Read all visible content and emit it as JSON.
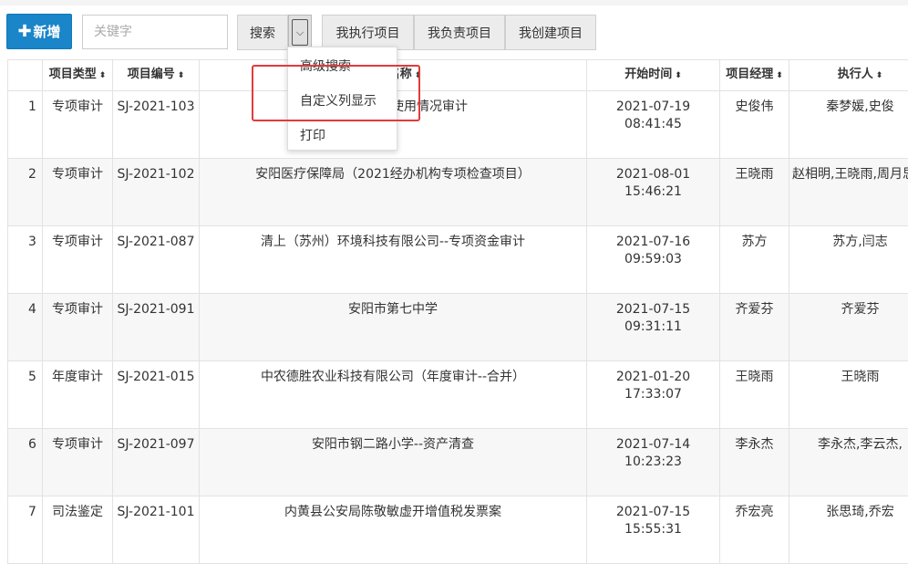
{
  "toolbar": {
    "add_label": "新增",
    "add_icon": "plus-icon",
    "keyword_placeholder": "关键字",
    "search_label": "搜索",
    "caret_icon": "chevron-down-icon",
    "filters": [
      "我执行项目",
      "我负责项目",
      "我创建项目"
    ]
  },
  "dropdown": {
    "items": [
      "高级搜索",
      "自定义列显示",
      "打印"
    ],
    "highlight_color": "#e23a3a"
  },
  "table": {
    "columns": [
      "",
      "项目类型",
      "项目编号",
      "项目名称",
      "开始时间",
      "项目经理",
      "执行人"
    ],
    "rows": [
      {
        "index": "1",
        "type": "专项审计",
        "code": "SJ-2021-103",
        "name": "大……--资金使用情况审计",
        "start": "2021-07-19 08:41:45",
        "manager": "史俊伟",
        "executor": "秦梦媛,史俊"
      },
      {
        "index": "2",
        "type": "专项审计",
        "code": "SJ-2021-102",
        "name": "安阳医疗保障局（2021经办机构专项检查项目）",
        "start": "2021-08-01 15:46:21",
        "manager": "王晓雨",
        "executor": "赵相明,王晓雨,周月思雨"
      },
      {
        "index": "3",
        "type": "专项审计",
        "code": "SJ-2021-087",
        "name": "清上（苏州）环境科技有限公司--专项资金审计",
        "start": "2021-07-16 09:59:03",
        "manager": "苏方",
        "executor": "苏方,闫志"
      },
      {
        "index": "4",
        "type": "专项审计",
        "code": "SJ-2021-091",
        "name": "安阳市第七中学",
        "start": "2021-07-15 09:31:11",
        "manager": "齐爱芬",
        "executor": "齐爱芬"
      },
      {
        "index": "5",
        "type": "年度审计",
        "code": "SJ-2021-015",
        "name": "中农德胜农业科技有限公司（年度审计--合并）",
        "start": "2021-01-20 17:33:07",
        "manager": "王晓雨",
        "executor": "王晓雨"
      },
      {
        "index": "6",
        "type": "专项审计",
        "code": "SJ-2021-097",
        "name": "安阳市钢二路小学--资产清查",
        "start": "2021-07-14 10:23:23",
        "manager": "李永杰",
        "executor": "李永杰,李云杰,"
      },
      {
        "index": "7",
        "type": "司法鉴定",
        "code": "SJ-2021-101",
        "name": "内黄县公安局陈敬敏虚开增值税发票案",
        "start": "2021-07-15 15:55:31",
        "manager": "乔宏亮",
        "executor": "张思琦,乔宏"
      }
    ]
  },
  "colors": {
    "primary": "#1a85c9",
    "row_alt": "#f7f7f7"
  }
}
